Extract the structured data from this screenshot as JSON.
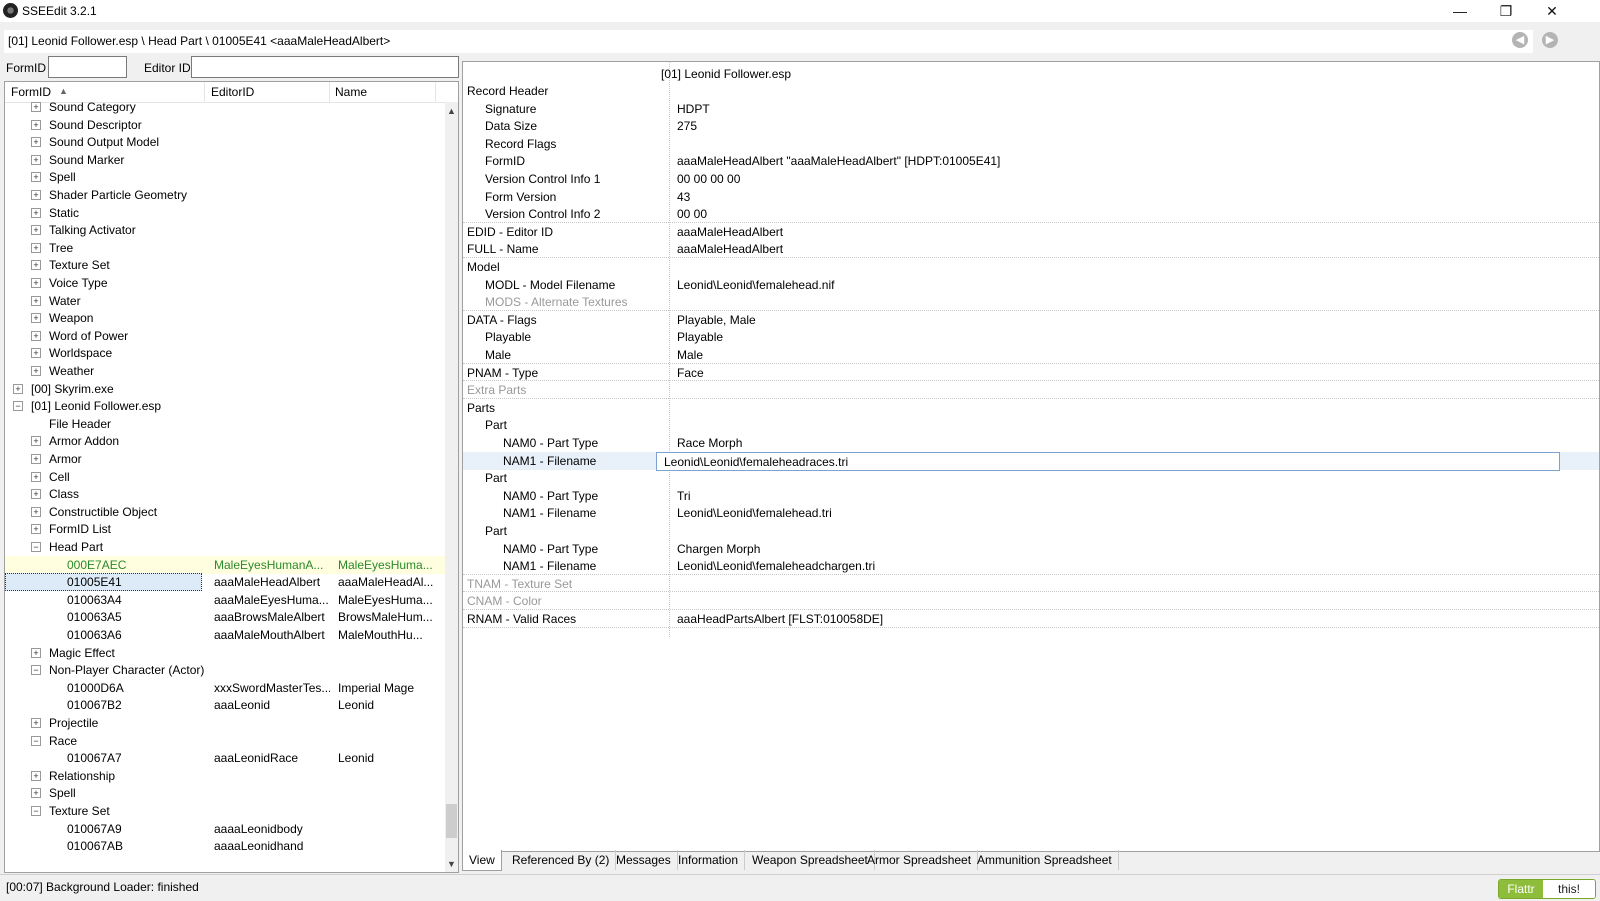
{
  "window": {
    "title": "SSEEdit 3.2.1",
    "minimize": "—",
    "maximize": "❐",
    "close": "✕"
  },
  "path_bar": {
    "text": "[01] Leonid Follower.esp \\ Head Part \\ 01005E41 <aaaMaleHeadAlbert>"
  },
  "filters": {
    "formid_label": "FormID",
    "formid_value": "",
    "editorid_label": "Editor ID",
    "editorid_value": ""
  },
  "tree": {
    "columns": [
      "FormID",
      "EditorID",
      "Name"
    ],
    "sort_indicator": "▲",
    "rows": [
      {
        "formid": "Sound Category",
        "editorid": "",
        "name": ""
      },
      {
        "formid": "Sound Descriptor",
        "editorid": "",
        "name": ""
      },
      {
        "formid": "Sound Output Model",
        "editorid": "",
        "name": ""
      },
      {
        "formid": "Sound Marker",
        "editorid": "",
        "name": ""
      },
      {
        "formid": "Spell",
        "editorid": "",
        "name": ""
      },
      {
        "formid": "Shader Particle Geometry",
        "editorid": "",
        "name": ""
      },
      {
        "formid": "Static",
        "editorid": "",
        "name": ""
      },
      {
        "formid": "Talking Activator",
        "editorid": "",
        "name": ""
      },
      {
        "formid": "Tree",
        "editorid": "",
        "name": ""
      },
      {
        "formid": "Texture Set",
        "editorid": "",
        "name": ""
      },
      {
        "formid": "Voice Type",
        "editorid": "",
        "name": ""
      },
      {
        "formid": "Water",
        "editorid": "",
        "name": ""
      },
      {
        "formid": "Weapon",
        "editorid": "",
        "name": ""
      },
      {
        "formid": "Word of Power",
        "editorid": "",
        "name": ""
      },
      {
        "formid": "Worldspace",
        "editorid": "",
        "name": ""
      },
      {
        "formid": "Weather",
        "editorid": "",
        "name": ""
      },
      {
        "formid": "[00] Skyrim.exe",
        "editorid": "",
        "name": ""
      },
      {
        "formid": "[01] Leonid Follower.esp",
        "editorid": "",
        "name": ""
      },
      {
        "formid": "File Header",
        "editorid": "",
        "name": ""
      },
      {
        "formid": "Armor Addon",
        "editorid": "",
        "name": ""
      },
      {
        "formid": "Armor",
        "editorid": "",
        "name": ""
      },
      {
        "formid": "Cell",
        "editorid": "",
        "name": ""
      },
      {
        "formid": "Class",
        "editorid": "",
        "name": ""
      },
      {
        "formid": "Constructible Object",
        "editorid": "",
        "name": ""
      },
      {
        "formid": "FormID List",
        "editorid": "",
        "name": ""
      },
      {
        "formid": "Head Part",
        "editorid": "",
        "name": ""
      },
      {
        "formid": "000E7AEC",
        "editorid": "MaleEyesHumanA...",
        "name": "MaleEyesHuma..."
      },
      {
        "formid": "01005E41",
        "editorid": "aaaMaleHeadAlbert",
        "name": "aaaMaleHeadAl..."
      },
      {
        "formid": "010063A4",
        "editorid": "aaaMaleEyesHuma...",
        "name": "MaleEyesHuma..."
      },
      {
        "formid": "010063A5",
        "editorid": "aaaBrowsMaleAlbert",
        "name": "BrowsMaleHum..."
      },
      {
        "formid": "010063A6",
        "editorid": "aaaMaleMouthAlbert",
        "name": "MaleMouthHu..."
      },
      {
        "formid": "Magic Effect",
        "editorid": "",
        "name": ""
      },
      {
        "formid": "Non-Player Character (Actor)",
        "editorid": "",
        "name": ""
      },
      {
        "formid": "01000D6A",
        "editorid": "xxxSwordMasterTes...",
        "name": "Imperial Mage"
      },
      {
        "formid": "010067B2",
        "editorid": "aaaLeonid",
        "name": "Leonid"
      },
      {
        "formid": "Projectile",
        "editorid": "",
        "name": ""
      },
      {
        "formid": "Race",
        "editorid": "",
        "name": ""
      },
      {
        "formid": "010067A7",
        "editorid": "aaaLeonidRace",
        "name": "Leonid"
      },
      {
        "formid": "Relationship",
        "editorid": "",
        "name": ""
      },
      {
        "formid": "Spell",
        "editorid": "",
        "name": ""
      },
      {
        "formid": "Texture Set",
        "editorid": "",
        "name": ""
      },
      {
        "formid": "010067A9",
        "editorid": "aaaaLeonidbody",
        "name": ""
      },
      {
        "formid": "010067AB",
        "editorid": "aaaaLeonidhand",
        "name": ""
      }
    ]
  },
  "record": {
    "file_header": "[01] Leonid Follower.esp",
    "rows": [
      {
        "label": "Record Header",
        "value": ""
      },
      {
        "label": "Signature",
        "value": "HDPT"
      },
      {
        "label": "Data Size",
        "value": "275"
      },
      {
        "label": "Record Flags",
        "value": ""
      },
      {
        "label": "FormID",
        "value": "aaaMaleHeadAlbert \"aaaMaleHeadAlbert\" [HDPT:01005E41]"
      },
      {
        "label": "Version Control Info 1",
        "value": "00 00 00 00"
      },
      {
        "label": "Form Version",
        "value": "43"
      },
      {
        "label": "Version Control Info 2",
        "value": "00 00"
      },
      {
        "label": "EDID - Editor ID",
        "value": "aaaMaleHeadAlbert"
      },
      {
        "label": "FULL - Name",
        "value": "aaaMaleHeadAlbert"
      },
      {
        "label": "Model",
        "value": ""
      },
      {
        "label": "MODL - Model Filename",
        "value": "Leonid\\Leonid\\femalehead.nif"
      },
      {
        "label": "MODS - Alternate Textures",
        "value": ""
      },
      {
        "label": "DATA - Flags",
        "value": "Playable, Male"
      },
      {
        "label": "Playable",
        "value": "Playable"
      },
      {
        "label": "Male",
        "value": "Male"
      },
      {
        "label": "PNAM - Type",
        "value": "Face"
      },
      {
        "label": "Extra Parts",
        "value": ""
      },
      {
        "label": "Parts",
        "value": ""
      },
      {
        "label": "Part",
        "value": ""
      },
      {
        "label": "NAM0 - Part Type",
        "value": "Race Morph"
      },
      {
        "label": "NAM1 - Filename",
        "value": "Leonid\\Leonid\\femaleheadraces.tri"
      },
      {
        "label": "Part",
        "value": ""
      },
      {
        "label": "NAM0 - Part Type",
        "value": "Tri"
      },
      {
        "label": "NAM1 - Filename",
        "value": "Leonid\\Leonid\\femalehead.tri"
      },
      {
        "label": "Part",
        "value": ""
      },
      {
        "label": "NAM0 - Part Type",
        "value": "Chargen Morph"
      },
      {
        "label": "NAM1 - Filename",
        "value": "Leonid\\Leonid\\femaleheadchargen.tri"
      },
      {
        "label": "TNAM - Texture Set",
        "value": ""
      },
      {
        "label": "CNAM - Color",
        "value": ""
      },
      {
        "label": "RNAM - Valid Races",
        "value": "aaaHeadPartsAlbert [FLST:010058DE]"
      }
    ]
  },
  "tabs": [
    "View",
    "Referenced By (2)",
    "Messages",
    "Information",
    "Weapon Spreadsheet",
    "Armor Spreadsheet",
    "Ammunition Spreadsheet"
  ],
  "status": {
    "text": "[00:07] Background Loader: finished"
  },
  "flattr": {
    "left": "Flattr",
    "right": "this!"
  },
  "colors": {
    "highlight_green": "#2a8a2a",
    "selection": "#dcebf7",
    "flattr_green": "#8dbd3a"
  }
}
